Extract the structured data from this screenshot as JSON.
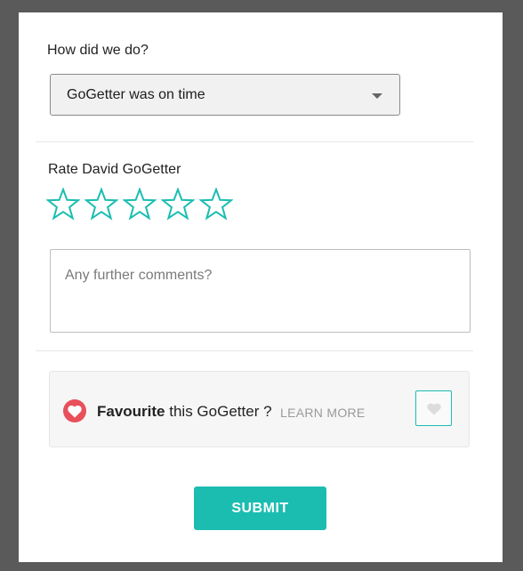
{
  "feedback": {
    "question": "How did we do?",
    "selected_option": "GoGetter was on time"
  },
  "rating": {
    "label": "Rate David GoGetter",
    "max_stars": 5,
    "value": 0,
    "star_color": "#1bbdb1"
  },
  "comments": {
    "placeholder": "Any further comments?",
    "value": ""
  },
  "favourite": {
    "bold_text": "Favourite",
    "rest_text": " this GoGetter ?",
    "learn_more": "LEARN MORE",
    "heart_color": "#e8505b",
    "active": false
  },
  "submit_label": "SUBMIT",
  "colors": {
    "accent": "#1bbdb1",
    "backdrop": "#5a5a5a"
  }
}
